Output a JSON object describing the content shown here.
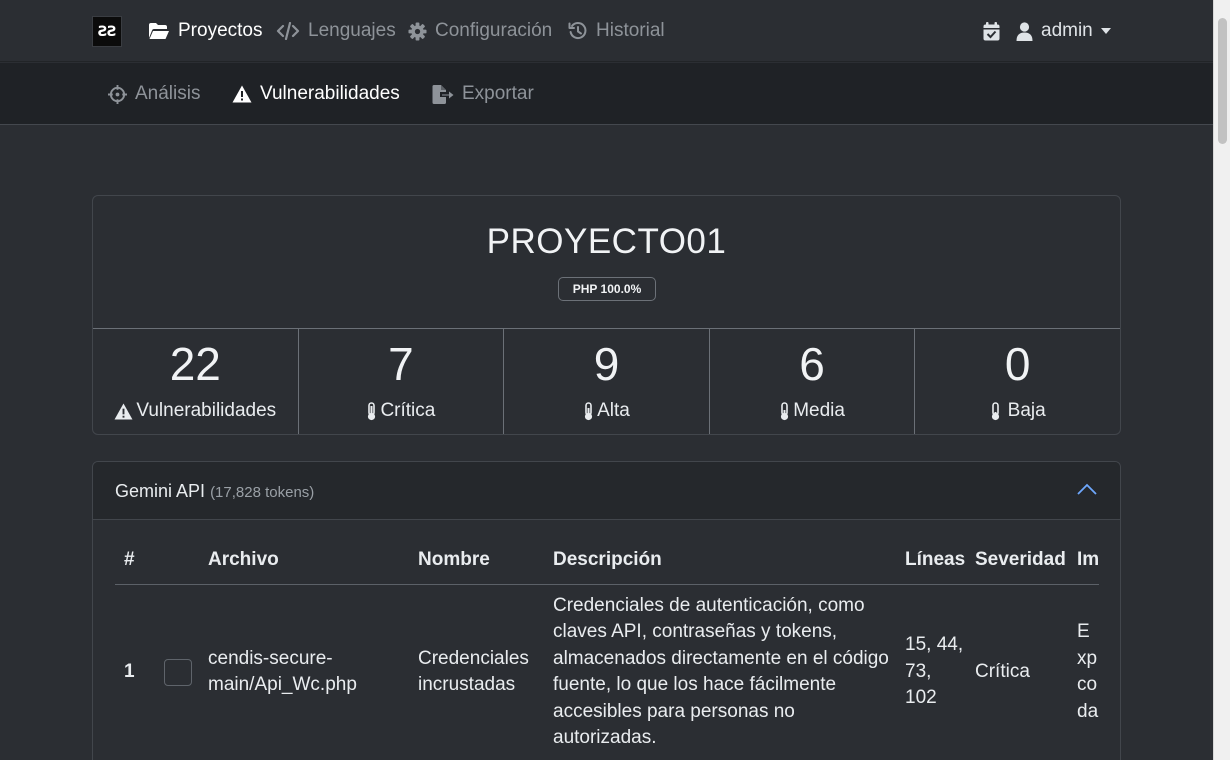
{
  "topnav": {
    "logo": "ƧƧ",
    "items": [
      {
        "label": "Proyectos"
      },
      {
        "label": "Lenguajes"
      },
      {
        "label": "Configuración"
      },
      {
        "label": "Historial"
      }
    ],
    "user": "admin"
  },
  "subnav": {
    "items": [
      {
        "label": "Análisis"
      },
      {
        "label": "Vulnerabilidades"
      },
      {
        "label": "Exportar"
      }
    ]
  },
  "project": {
    "name": "PROYECTO01",
    "language_badge": "PHP 100.0%",
    "stats": [
      {
        "value": "22",
        "label": "Vulnerabilidades"
      },
      {
        "value": "7",
        "label": "Crítica"
      },
      {
        "value": "9",
        "label": "Alta"
      },
      {
        "value": "6",
        "label": "Media"
      },
      {
        "value": "0",
        "label": "Baja"
      }
    ]
  },
  "panel": {
    "title": "Gemini API",
    "tokens": "(17,828 tokens)",
    "columns": [
      "#",
      "Archivo",
      "Nombre",
      "Descripción",
      "Líneas",
      "Severidad",
      "Im"
    ],
    "rows": [
      {
        "num": "1",
        "file": "cendis-secure-main/Api_Wc.php",
        "name": "Credenciales incrustadas",
        "description": "Credenciales de autenticación, como claves API, contraseñas y tokens, almacenados directamente en el código fuente, lo que los hace fácilmente accesibles para personas no autorizadas.",
        "lines": "15, 44, 73, 102",
        "severity": "Crítica",
        "impact": "Exp co da"
      }
    ]
  }
}
